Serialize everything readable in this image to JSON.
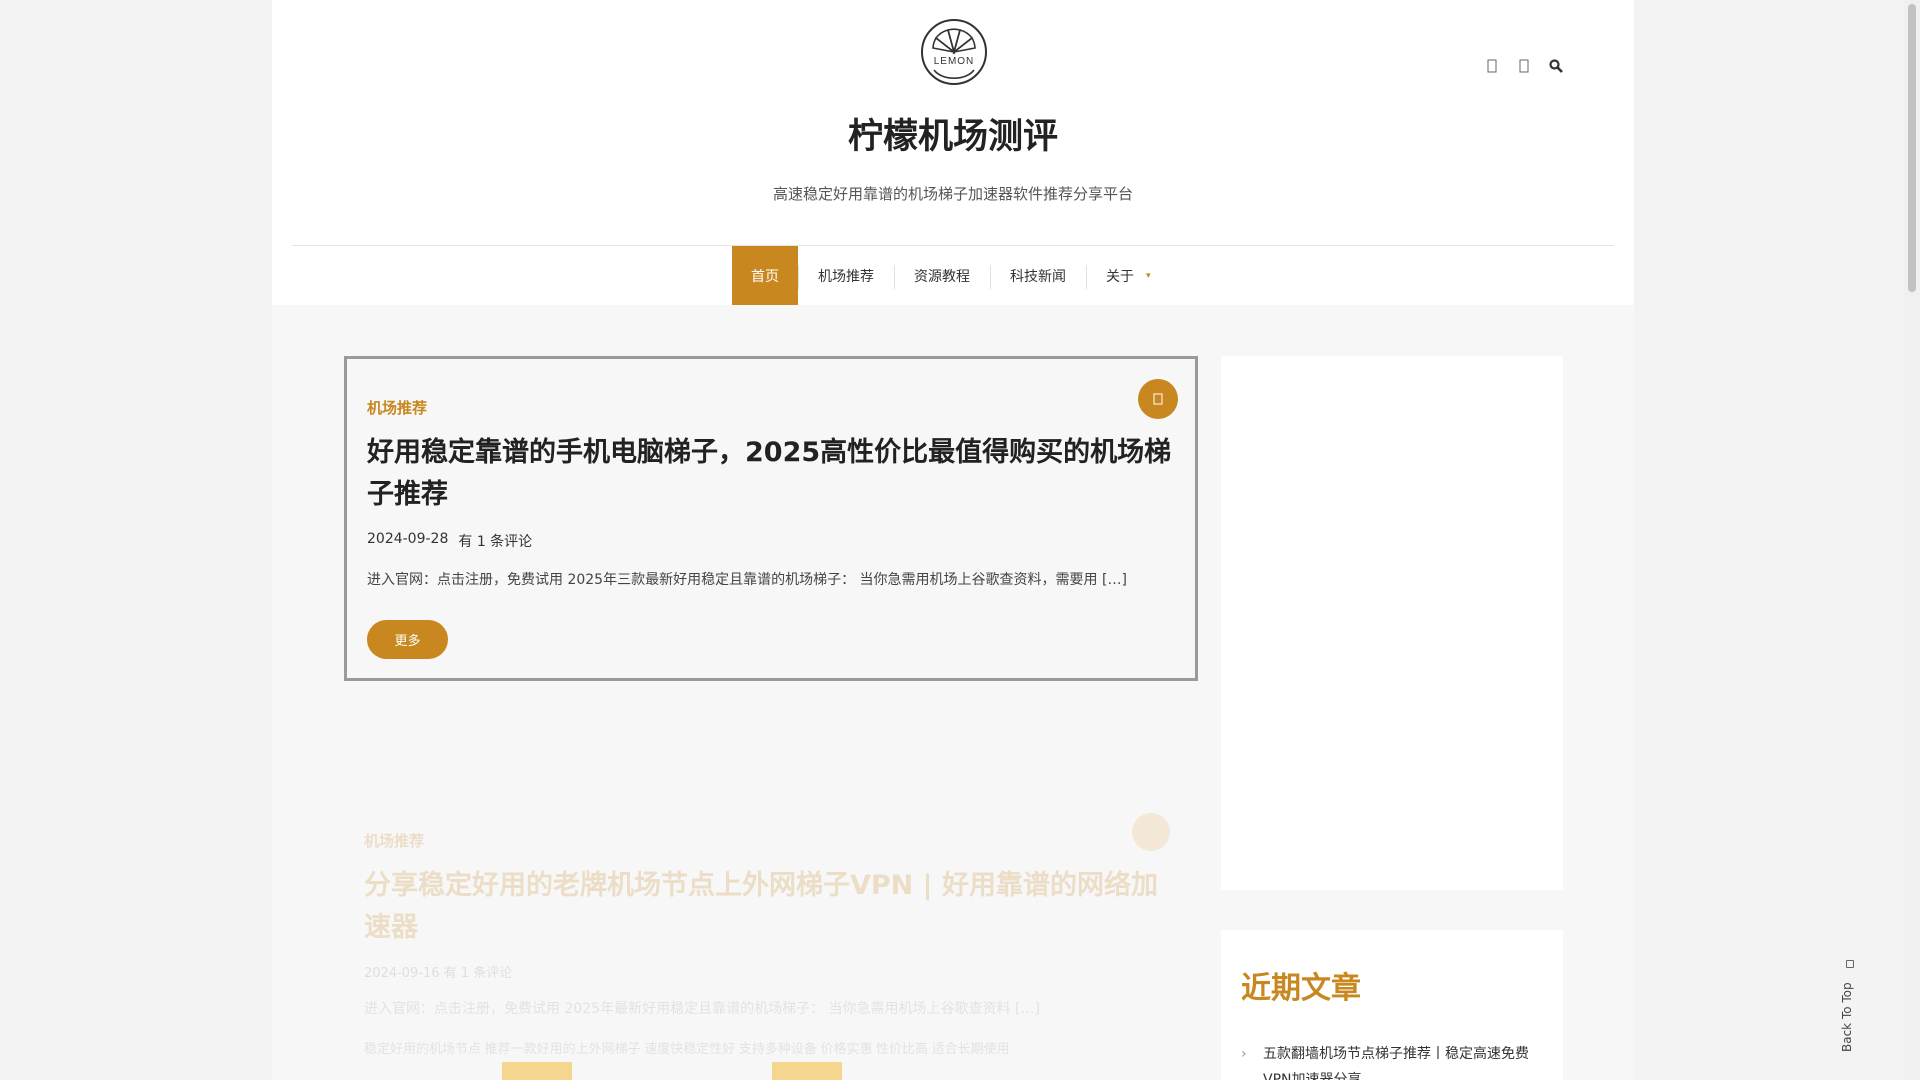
{
  "site": {
    "logo_text": "LEMON",
    "title": "柠檬机场测评",
    "tagline": "高速稳定好用靠谱的机场梯子加速器软件推荐分享平台"
  },
  "header_icons": [
    "facebook-icon",
    "twitter-icon",
    "search-icon"
  ],
  "nav": {
    "items": [
      {
        "label": "首页",
        "active": true
      },
      {
        "label": "机场推荐"
      },
      {
        "label": "资源教程"
      },
      {
        "label": "科技新闻"
      },
      {
        "label": "关于",
        "has_dropdown": true
      }
    ]
  },
  "posts": [
    {
      "category": "机场推荐",
      "title": "好用稳定靠谱的手机电脑梯子，2025高性价比最值得购买的机场梯子推荐",
      "date": "2024-09-28",
      "comments": "有 1 条评论",
      "excerpt": "进入官网：点击注册，免费试用 2025年三款最新好用稳定且靠谱的机场梯子： 当你急需用机场上谷歌查资料，需要用 […]",
      "more_label": "更多"
    },
    {
      "category": "机场推荐",
      "title": "分享稳定好用的老牌机场节点上外网梯子VPN | 好用靠谱的网络加速器",
      "meta": "2024-09-16  有 1 条评论",
      "excerpt": "进入官网：点击注册，免费试用 2025年最新好用稳定且靠谱的机场梯子： 当你急需用机场上谷歌查资料 […]",
      "excerpt2": "稳定好用的机场节点 推荐一款好用的上外网梯子 速度快稳定性好 支持多种设备 价格实惠 性价比高 适合长期使用"
    }
  ],
  "sidebar": {
    "recent_title": "近期文章",
    "recent_items": [
      "五款翻墙机场节点梯子推荐丨稳定高速免费VPN加速器分享"
    ]
  },
  "back_to_top": "Back To Top",
  "colors": {
    "accent": "#c8871f",
    "title": "#222222",
    "page_bg": "#f7f7f7"
  }
}
